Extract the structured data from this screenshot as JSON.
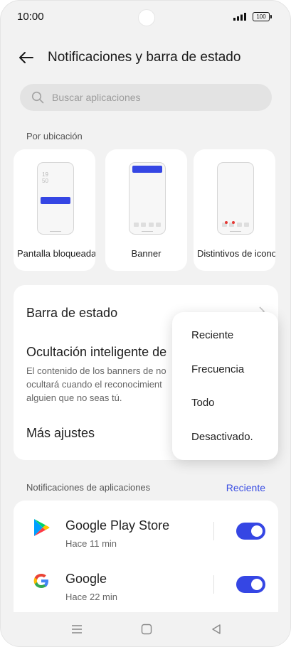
{
  "status_bar": {
    "time": "10:00",
    "battery": "100"
  },
  "header": {
    "title": "Notificaciones y barra de estado"
  },
  "search": {
    "placeholder": "Buscar aplicaciones"
  },
  "location_section": {
    "label": "Por ubicación",
    "cards": [
      {
        "label": "Pantalla bloqueada",
        "clock": [
          "19",
          "50"
        ]
      },
      {
        "label": "Banner"
      },
      {
        "label": "Distintivos de iconos"
      }
    ]
  },
  "settings": {
    "status_bar": "Barra de estado",
    "smart_hide": {
      "title": "Ocultación inteligente de",
      "description": "El contenido de los banners de no\nocultará cuando el reconocimient\nalguien que no seas tú."
    },
    "more": "Más ajustes"
  },
  "dropdown": {
    "options": [
      "Reciente",
      "Frecuencia",
      "Todo",
      "Desactivado."
    ]
  },
  "apps_section": {
    "label": "Notificaciones de aplicaciones",
    "sort_value": "Reciente",
    "apps": [
      {
        "name": "Google Play Store",
        "time": "Hace 11 min",
        "enabled": true
      },
      {
        "name": "Google",
        "time": "Hace 22 min",
        "enabled": true
      }
    ]
  },
  "colors": {
    "accent": "#3546e4",
    "link": "#3a4ee3",
    "background": "#f2f2f2",
    "card": "#ffffff"
  },
  "icons": [
    "back-arrow-icon",
    "search-icon",
    "chevron-right-icon",
    "google-play-icon",
    "google-icon",
    "menu-icon",
    "home-icon",
    "back-icon"
  ]
}
